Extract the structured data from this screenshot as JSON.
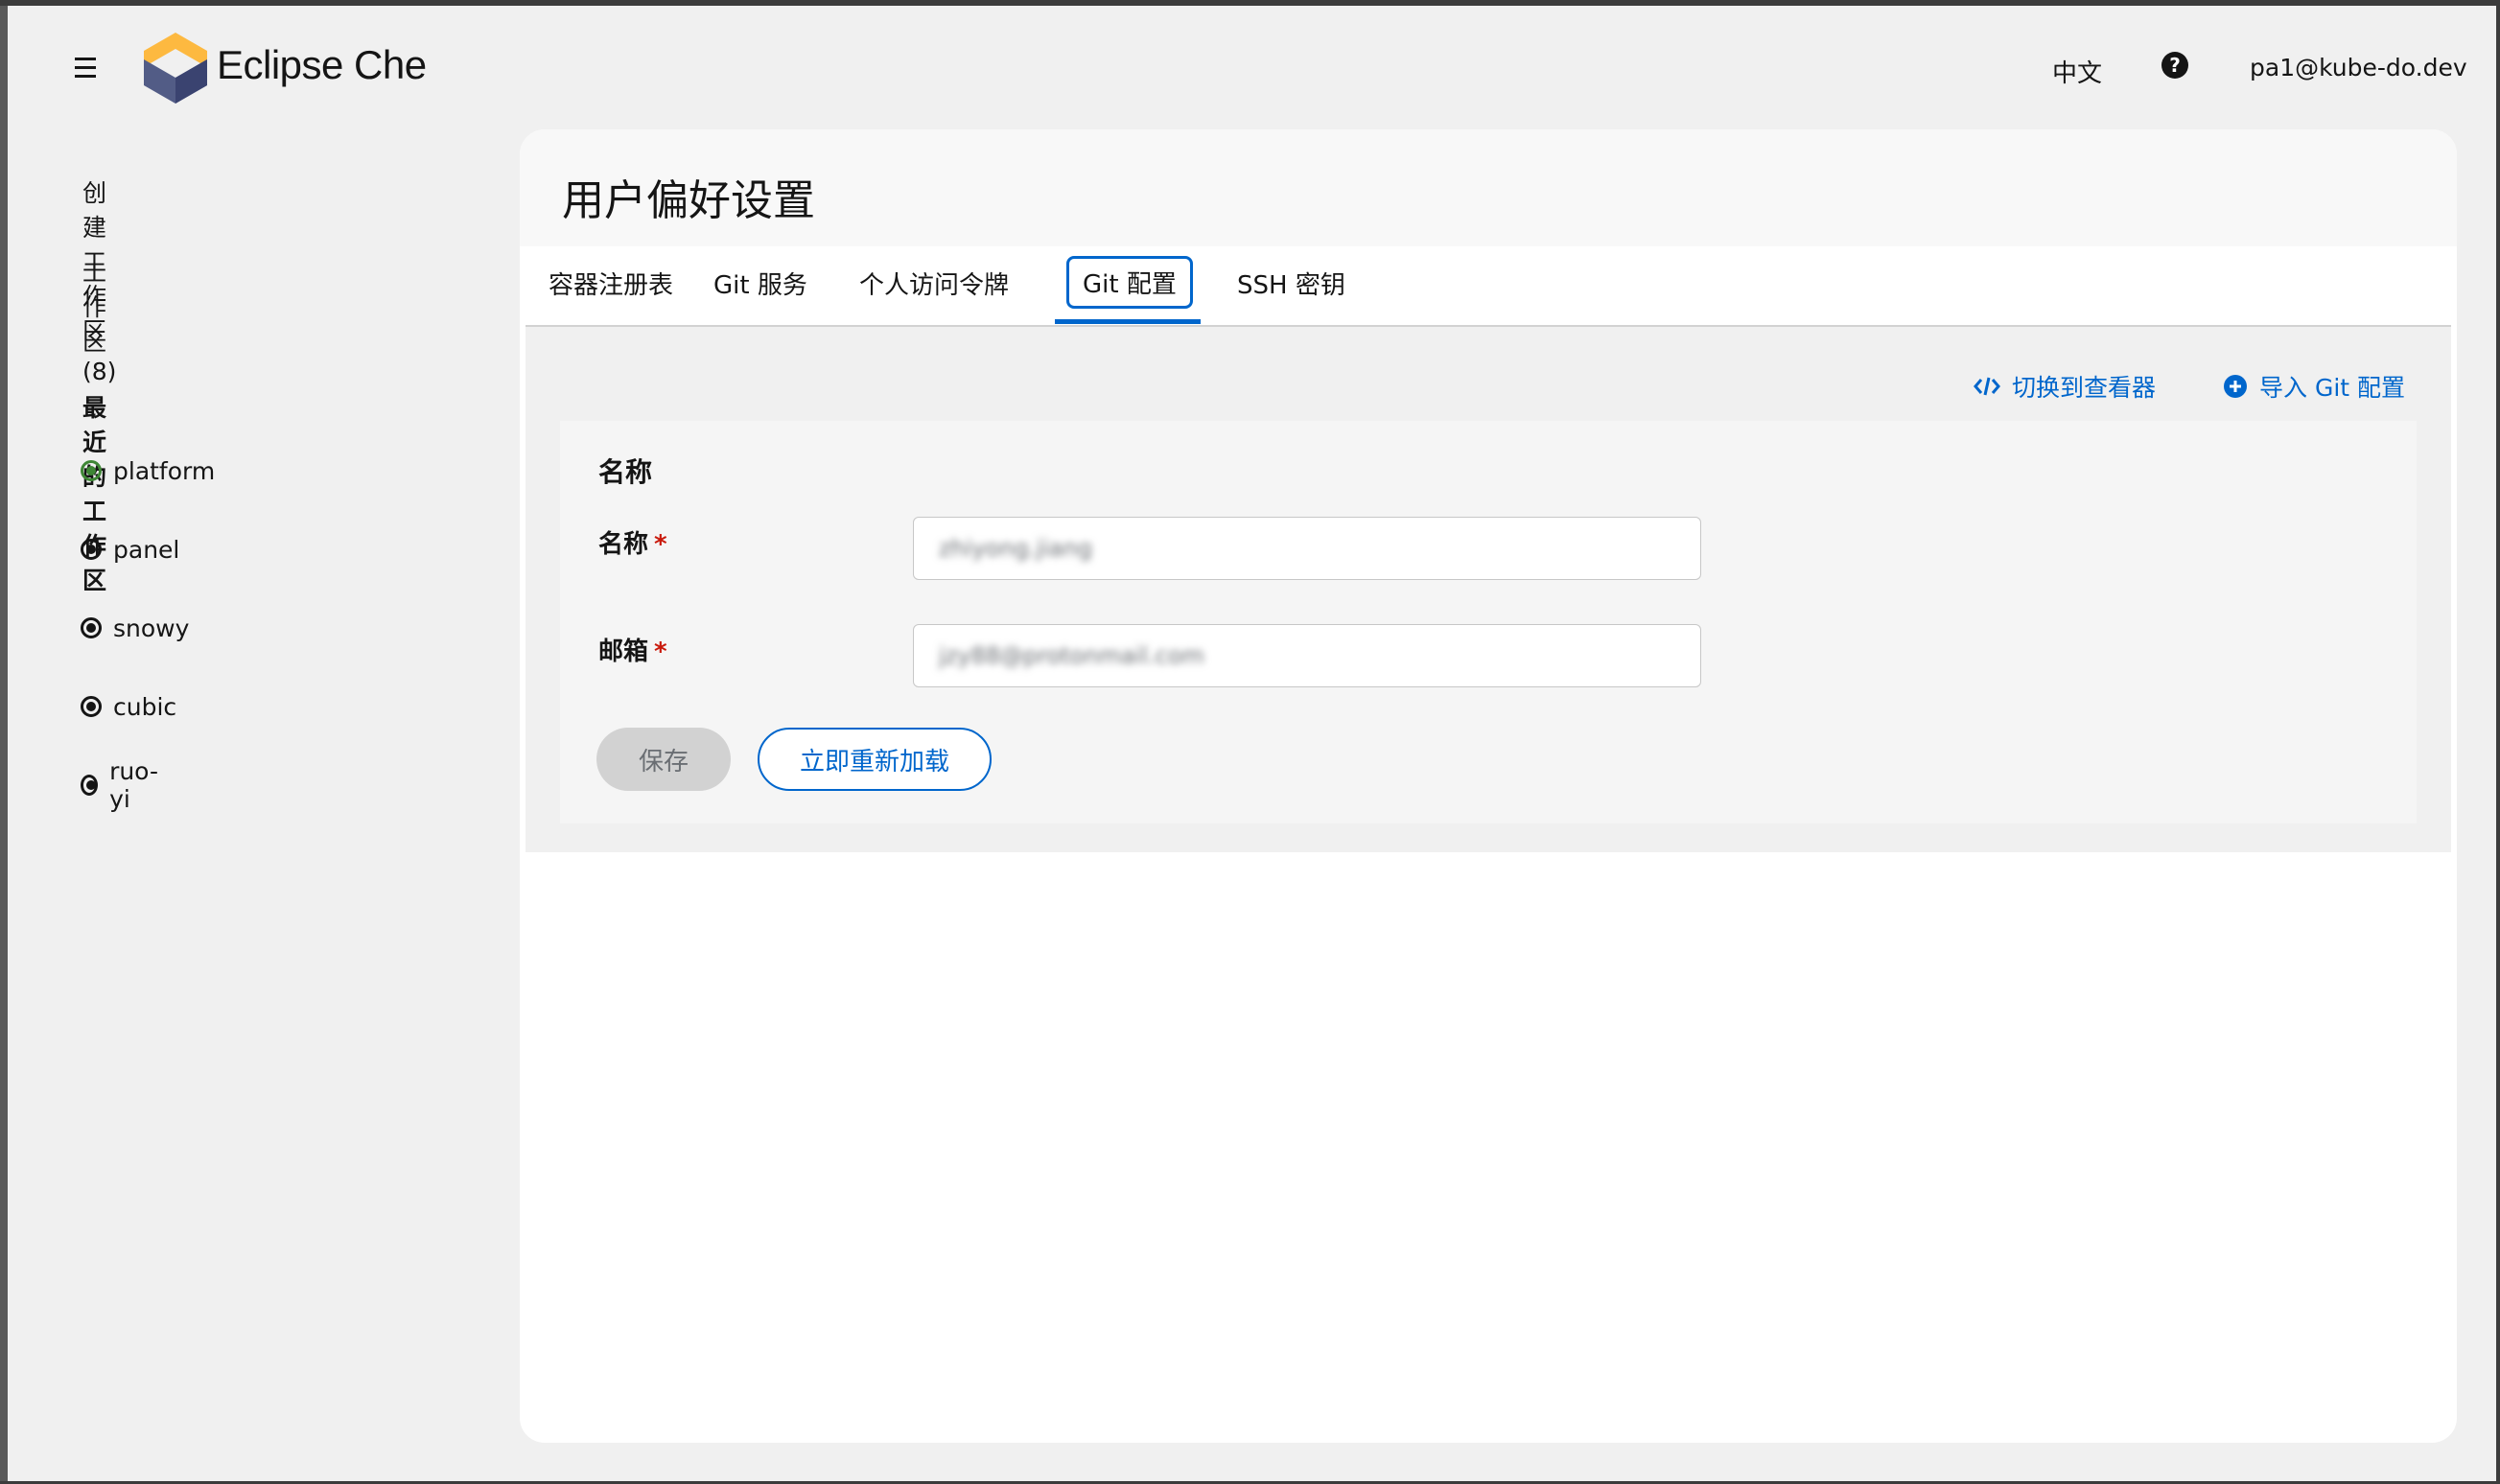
{
  "header": {
    "brand": "Eclipse Che",
    "language": "中文",
    "help_icon": "question-circle-icon",
    "user": "pa1@kube-do.dev"
  },
  "sidebar": {
    "create_workspace": "创建工作区",
    "workspaces": "工作区 (8)",
    "recent_title": "最近的工作区",
    "recent": [
      {
        "name": "platform",
        "status": "running",
        "color": "#3e8635"
      },
      {
        "name": "panel",
        "status": "stopped",
        "color": "#151515"
      },
      {
        "name": "snowy",
        "status": "stopped",
        "color": "#151515"
      },
      {
        "name": "cubic",
        "status": "stopped",
        "color": "#151515"
      },
      {
        "name": "ruo-yi",
        "status": "stopped",
        "color": "#151515"
      }
    ]
  },
  "page": {
    "title": "用户偏好设置",
    "tabs": [
      {
        "label": "容器注册表",
        "active": false
      },
      {
        "label": "Git 服务",
        "active": false
      },
      {
        "label": "个人访问令牌",
        "active": false
      },
      {
        "label": "Git 配置",
        "active": true
      },
      {
        "label": "SSH 密钥",
        "active": false
      }
    ],
    "actions": {
      "switch_viewer": "切换到查看器",
      "import_config": "导入 Git 配置"
    },
    "section_title": "名称",
    "fields": {
      "name_label": "名称",
      "name_value": "zhiyong.jiang",
      "email_label": "邮箱",
      "email_value": "jzy88@protonmail.com",
      "required_mark": "*"
    },
    "buttons": {
      "save": "保存",
      "reload": "立即重新加载"
    }
  },
  "colors": {
    "accent": "#0066cc",
    "running": "#3e8635",
    "required": "#c9190b"
  }
}
